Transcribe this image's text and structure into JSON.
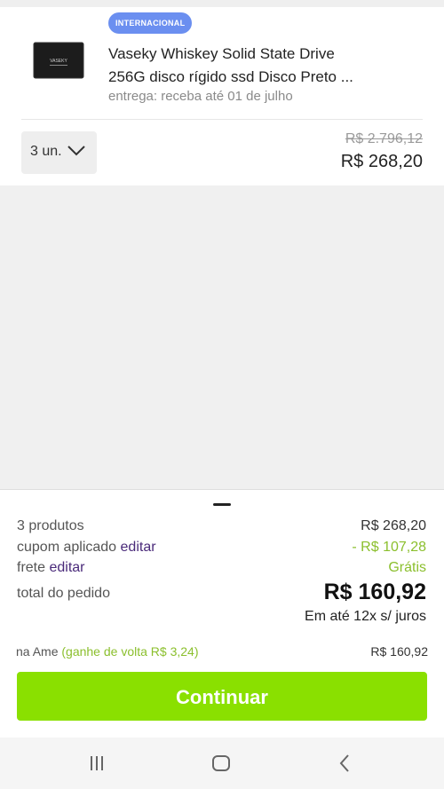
{
  "product": {
    "badge": "INTERNACIONAL",
    "thumbnail_brand": "VASEKY",
    "title_line1": "Vaseky Whiskey Solid State Drive",
    "title_line2": "256G disco rígido ssd Disco Preto ...",
    "delivery": "entrega: receba até 01 de julho",
    "quantity": "3 un.",
    "old_price": "R$ 2.796,12",
    "price": "R$ 268,20"
  },
  "summary": {
    "products_label": "3 produtos",
    "products_value": "R$ 268,20",
    "coupon_label": "cupom aplicado",
    "coupon_edit": "editar",
    "coupon_value": "- R$ 107,28",
    "shipping_label": "frete",
    "shipping_edit": "editar",
    "shipping_value": "Grátis",
    "total_label": "total do pedido",
    "total_value": "R$ 160,92",
    "installments": "Em até 12x s/ juros",
    "ame_label": "na Ame",
    "ame_cashback": "(ganhe de volta R$ 3,24)",
    "ame_value": "R$ 160,92",
    "continue_label": "Continuar"
  },
  "nav": {
    "icons": [
      "recent-apps-icon",
      "home-icon",
      "back-icon"
    ]
  },
  "colors": {
    "accent_green": "#8ae000",
    "discount_green": "#8bbf2d",
    "badge_blue": "#6b8ff0",
    "link_purple": "#4a2a7a"
  }
}
